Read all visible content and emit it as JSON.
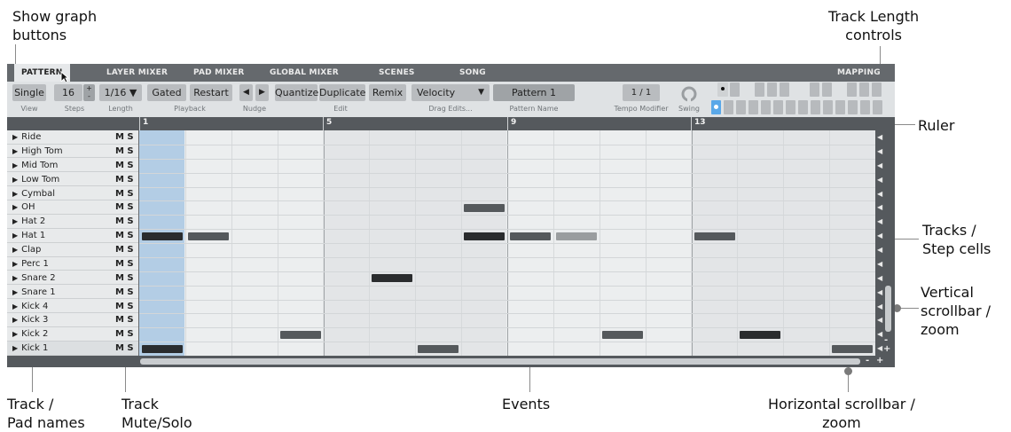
{
  "annotations": {
    "show_graph": "Show graph\nbuttons",
    "track_length": "Track Length\ncontrols",
    "ruler": "Ruler",
    "tracks_cells": "Tracks /\nStep cells",
    "vscroll": "Vertical\nscrollbar /\nzoom",
    "track_names": "Track /\nPad names",
    "track_mute": "Track\nMute/Solo",
    "events": "Events",
    "hscroll": "Horizontal scrollbar /\nzoom"
  },
  "tabs": [
    "PATTERN",
    "LAYER MIXER",
    "PAD MIXER",
    "GLOBAL MIXER",
    "SCENES",
    "SONG",
    "MAPPING"
  ],
  "toolbar": {
    "view": "Single",
    "view_label": "View",
    "steps": "16",
    "steps_up": "+",
    "steps_down": "-",
    "steps_label": "Steps",
    "length": "1/16 ▼",
    "length_label": "Length",
    "gated": "Gated",
    "restart": "Restart",
    "playback_label": "Playback",
    "nudge_left": "◀",
    "nudge_right": "▶",
    "nudge_label": "Nudge",
    "quantize": "Quantize",
    "duplicate": "Duplicate",
    "remix": "Remix",
    "edit_label": "Edit",
    "drag_edits": "Velocity",
    "drag_arrow": "▼",
    "drag_label": "Drag Edits...",
    "pattern_name": "Pattern 1",
    "pattern_label": "Pattern Name",
    "tempo": "1 / 1",
    "tempo_label": "Tempo Modifier",
    "swing_label": "Swing"
  },
  "ruler": [
    "1",
    "5",
    "9",
    "13"
  ],
  "tracks": [
    {
      "name": "Ride",
      "ms": "M S"
    },
    {
      "name": "High Tom",
      "ms": "M S"
    },
    {
      "name": "Mid Tom",
      "ms": "M S"
    },
    {
      "name": "Low Tom",
      "ms": "M S"
    },
    {
      "name": "Cymbal",
      "ms": "M S"
    },
    {
      "name": "OH",
      "ms": "M S"
    },
    {
      "name": "Hat 2",
      "ms": "M S"
    },
    {
      "name": "Hat 1",
      "ms": "M S"
    },
    {
      "name": "Clap",
      "ms": "M S"
    },
    {
      "name": "Perc 1",
      "ms": "M S"
    },
    {
      "name": "Snare 2",
      "ms": "M S"
    },
    {
      "name": "Snare 1",
      "ms": "M S"
    },
    {
      "name": "Kick 4",
      "ms": "M S"
    },
    {
      "name": "Kick 3",
      "ms": "M S"
    },
    {
      "name": "Kick 2",
      "ms": "M S"
    },
    {
      "name": "Kick 1",
      "ms": "M S"
    }
  ],
  "events": [
    {
      "track": 5,
      "step": 7,
      "shade": "mid"
    },
    {
      "track": 7,
      "step": 0,
      "shade": "dark"
    },
    {
      "track": 7,
      "step": 1,
      "shade": "mid"
    },
    {
      "track": 7,
      "step": 7,
      "shade": "dark"
    },
    {
      "track": 7,
      "step": 8,
      "shade": "mid"
    },
    {
      "track": 7,
      "step": 9,
      "shade": "light"
    },
    {
      "track": 7,
      "step": 12,
      "shade": "mid"
    },
    {
      "track": 10,
      "step": 5,
      "shade": "dark"
    },
    {
      "track": 14,
      "step": 3,
      "shade": "mid"
    },
    {
      "track": 14,
      "step": 10,
      "shade": "mid"
    },
    {
      "track": 14,
      "step": 13,
      "shade": "dark"
    },
    {
      "track": 15,
      "step": 0,
      "shade": "dark"
    },
    {
      "track": 15,
      "step": 6,
      "shade": "mid"
    },
    {
      "track": 15,
      "step": 15,
      "shade": "mid"
    }
  ],
  "colors": {
    "event_dark": "#2a2c2e",
    "event_mid": "#55595c",
    "event_light": "#9a9d9f",
    "playhead": "#b3cde5",
    "accent_blue": "#5aa8e8"
  },
  "icons": [
    "play-triangle-icon",
    "swing-knob-icon",
    "graph-button-icon",
    "scroll-arrow-icon",
    "zoom-plus-icon",
    "zoom-minus-icon"
  ]
}
